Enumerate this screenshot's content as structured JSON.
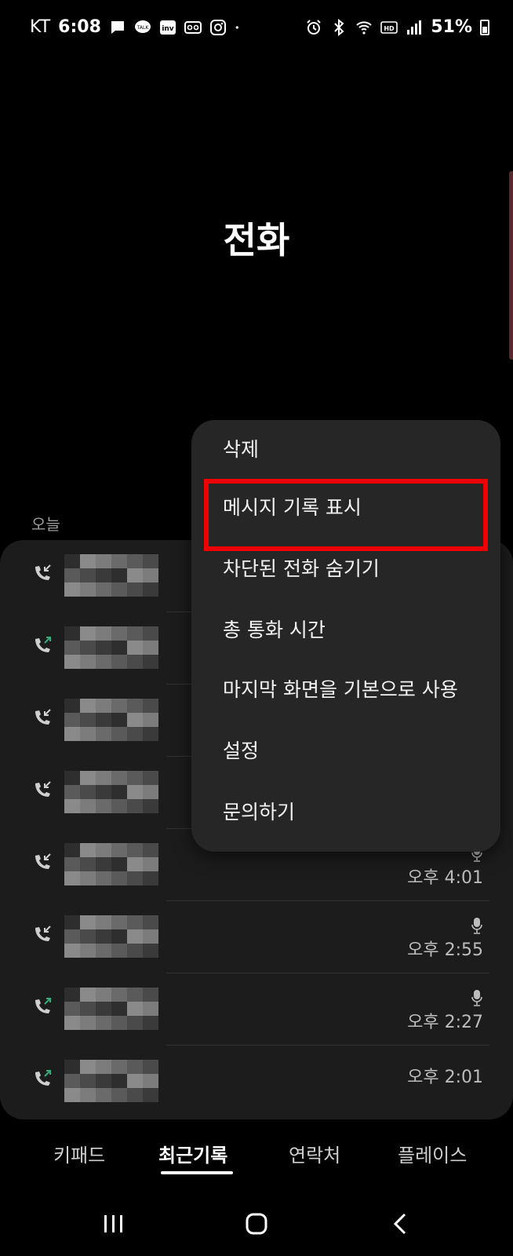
{
  "status_bar": {
    "carrier": "KT",
    "time": "6:08",
    "notif_icons": [
      "message-icon",
      "kakaotalk-icon",
      "inv-icon",
      "voicemail-icon",
      "instagram-icon",
      "dot-icon"
    ],
    "system_icons": [
      "alarm-icon",
      "bluetooth-icon",
      "wifi-icon",
      "hd-icon",
      "signal-icon",
      "battery-icon"
    ],
    "battery": "51%"
  },
  "header": {
    "title": "전화"
  },
  "section_label": "오늘",
  "calls": [
    {
      "direction": "incoming",
      "time": "",
      "recorded": false
    },
    {
      "direction": "outgoing",
      "time": "",
      "recorded": false
    },
    {
      "direction": "incoming",
      "time": "",
      "recorded": false
    },
    {
      "direction": "incoming",
      "time": "",
      "recorded": false
    },
    {
      "direction": "incoming",
      "time": "오후 4:01",
      "recorded": true
    },
    {
      "direction": "incoming",
      "time": "오후 2:55",
      "recorded": true
    },
    {
      "direction": "outgoing",
      "time": "오후 2:27",
      "recorded": true
    },
    {
      "direction": "outgoing",
      "time": "오후 2:01",
      "recorded": false
    }
  ],
  "menu": {
    "items": [
      "삭제",
      "메시지 기록 표시",
      "차단된 전화 숨기기",
      "총 통화 시간",
      "마지막 화면을 기본으로 사용",
      "설정",
      "문의하기"
    ],
    "highlighted_index": 1
  },
  "tabs": [
    "키패드",
    "최근기록",
    "연락처",
    "플레이스"
  ],
  "active_tab": "최근기록",
  "nav": [
    "recents-button",
    "home-button",
    "back-button"
  ],
  "colors": {
    "background": "#000000",
    "card": "#1c1c1c",
    "menu": "#262626",
    "highlight": "#ee0000",
    "outgoing": "#2fae7a",
    "incoming": "#cfcfcf"
  }
}
